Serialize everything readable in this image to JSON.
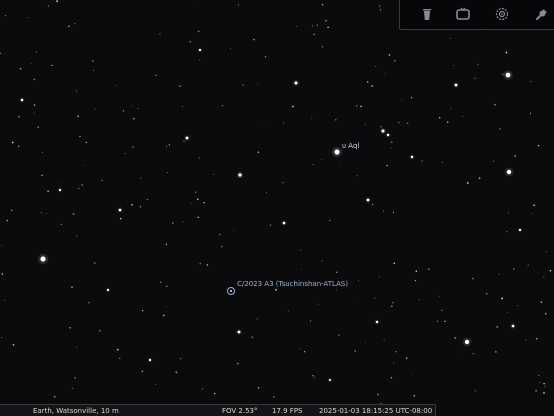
{
  "sky": {
    "star_label": "υ Aql",
    "comet_label": "C/2023 A3 (Tsuchinshan-ATLAS)"
  },
  "toolbar": {
    "icons": [
      "trash-icon",
      "tv-icon",
      "target-icon",
      "wrench-icon"
    ]
  },
  "status": {
    "location": "Earth, Watsonville, 10 m",
    "fov": "FOV 2.53°",
    "fps": "17.9 FPS",
    "datetime": "2025-01-03 18:15:25 UTC-08:00"
  },
  "colors": {
    "background": "#0b0b0d",
    "star": "#ffffff",
    "label": "#c9d3e6",
    "comet_label": "#9fb0d0"
  }
}
